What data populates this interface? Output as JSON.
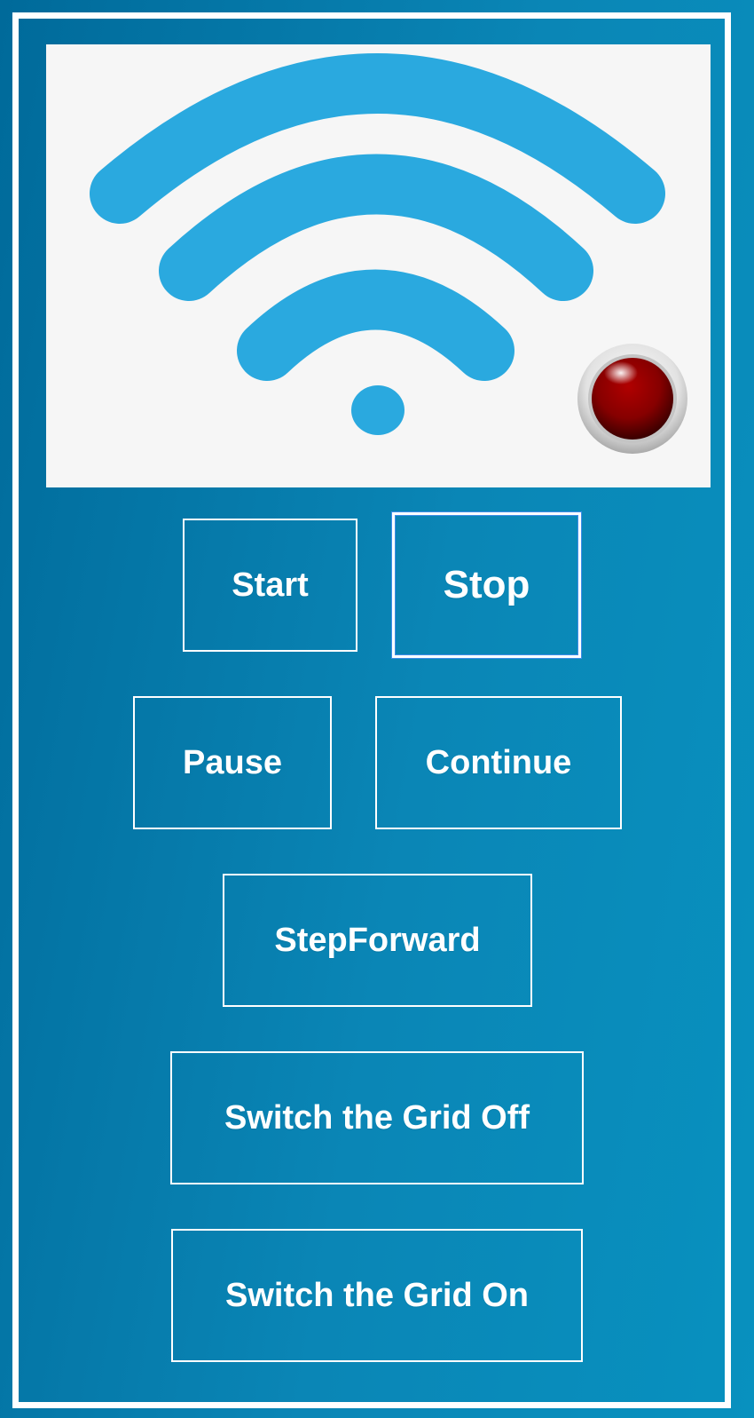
{
  "display": {
    "wifi_icon_color": "#2aa9df",
    "led_state": "off",
    "led_color": "#8b0000"
  },
  "controls": {
    "start_label": "Start",
    "stop_label": "Stop",
    "pause_label": "Pause",
    "continue_label": "Continue",
    "stepforward_label": "StepForward",
    "grid_off_label": "Switch the Grid Off",
    "grid_on_label": "Switch the Grid On",
    "focused": "Stop"
  },
  "colors": {
    "background_start": "#006a9a",
    "background_end": "#0891bf",
    "frame": "#ffffff",
    "focus_ring": "#3f8ee8"
  }
}
